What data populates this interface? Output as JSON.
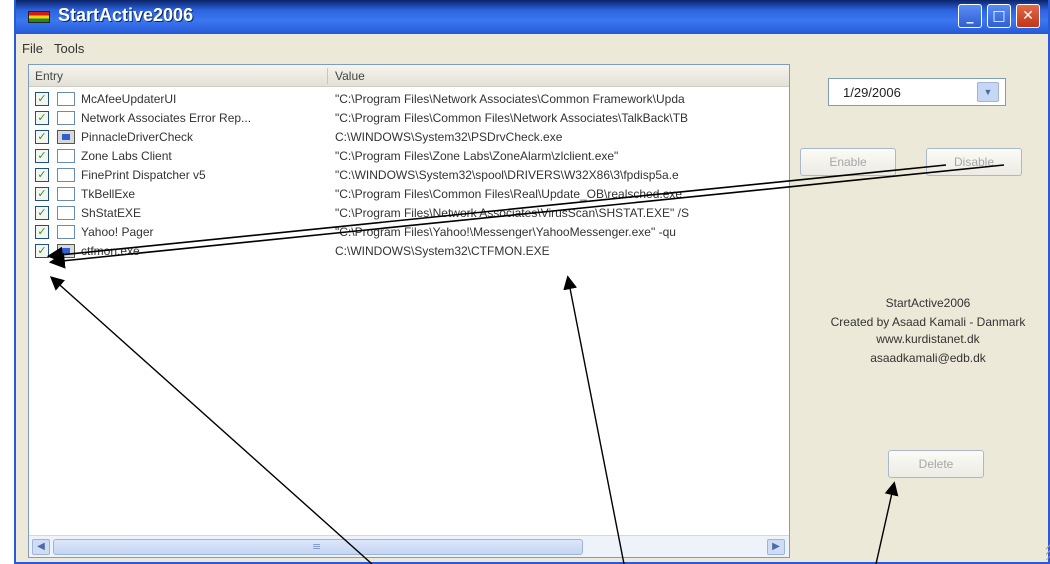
{
  "window": {
    "title": "StartActive2006",
    "controls": {
      "minimize": "_",
      "maximize": "□",
      "close": "✕"
    }
  },
  "menu": {
    "items": [
      "File",
      "Tools"
    ]
  },
  "list": {
    "columns": {
      "entry": "Entry",
      "value": "Value"
    },
    "rows": [
      {
        "entry": "McAfeeUpdaterUI",
        "value": "\"C:\\Program Files\\Network Associates\\Common Framework\\Upda",
        "checked": true,
        "icon": "blank-icon"
      },
      {
        "entry": "Network Associates Error Rep...",
        "value": "\"C:\\Program Files\\Common Files\\Network Associates\\TalkBack\\TB",
        "checked": true,
        "icon": "blank-icon"
      },
      {
        "entry": "PinnacleDriverCheck",
        "value": "C:\\WINDOWS\\System32\\PSDrvCheck.exe",
        "checked": true,
        "icon": "exe-icon"
      },
      {
        "entry": "Zone Labs Client",
        "value": "\"C:\\Program Files\\Zone Labs\\ZoneAlarm\\zlclient.exe\"",
        "checked": true,
        "icon": "blank-icon"
      },
      {
        "entry": "FinePrint Dispatcher v5",
        "value": "\"C:\\WINDOWS\\System32\\spool\\DRIVERS\\W32X86\\3\\fpdisp5a.e",
        "checked": true,
        "icon": "blank-icon"
      },
      {
        "entry": "TkBellExe",
        "value": "\"C:\\Program Files\\Common Files\\Real\\Update_OB\\realsched.exe",
        "checked": true,
        "icon": "blank-icon"
      },
      {
        "entry": "ShStatEXE",
        "value": "\"C:\\Program Files\\Network Associates\\VirusScan\\SHSTAT.EXE\" /S",
        "checked": true,
        "icon": "blank-icon"
      },
      {
        "entry": "Yahoo! Pager",
        "value": "\"C:\\Program Files\\Yahoo!\\Messenger\\YahooMessenger.exe\" -qu",
        "checked": true,
        "icon": "blank-icon"
      },
      {
        "entry": "ctfmon.exe",
        "value": "C:\\WINDOWS\\System32\\CTFMON.EXE",
        "checked": true,
        "icon": "exe-icon"
      }
    ],
    "scroll_left": "◀",
    "scroll_right": "▶"
  },
  "side": {
    "date": "1/29/2006",
    "date_dropdown": "▼",
    "enable_label": "Enable",
    "disable_label": "Disable",
    "delete_label": "Delete",
    "info": {
      "app_name": "StartActive2006",
      "created_by": "Created by Asaad Kamali - Danmark",
      "website": "www.kurdistanet.dk",
      "email": "asaadkamali@edb.dk"
    }
  },
  "colors": {
    "titlebar": "#2c63de",
    "window_bg": "#ece9d8",
    "check": "#21a121",
    "annotation_arrow": "#000000"
  }
}
